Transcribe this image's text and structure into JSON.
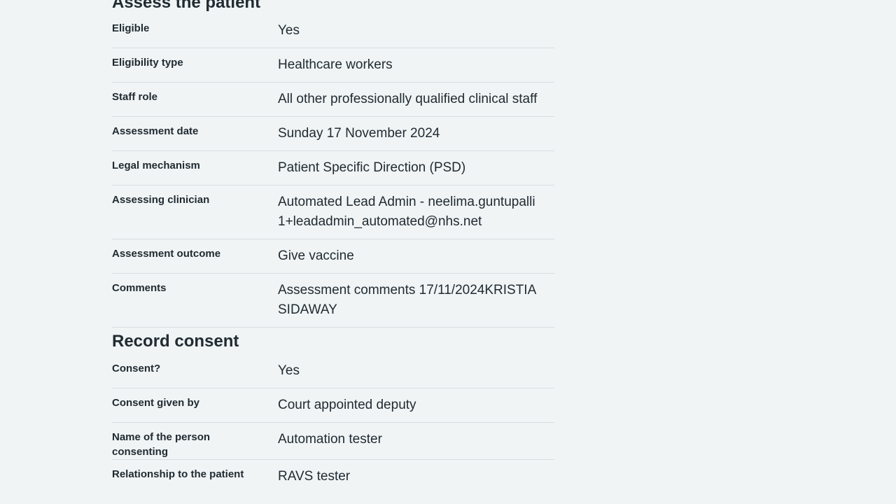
{
  "assess": {
    "heading": "Assess the patient",
    "rows": [
      {
        "key": "Eligible",
        "value": "Yes"
      },
      {
        "key": "Eligibility type",
        "value": "Healthcare workers"
      },
      {
        "key": "Staff role",
        "value": "All other professionally qualified clinical staff"
      },
      {
        "key": "Assessment date",
        "value": "Sunday 17 November 2024"
      },
      {
        "key": "Legal mechanism",
        "value": "Patient Specific Direction (PSD)"
      },
      {
        "key": "Assessing clinician",
        "value": "Automated Lead Admin - neelima.guntupalli1+leadadmin_automated@nhs.net"
      },
      {
        "key": "Assessment outcome",
        "value": "Give vaccine"
      },
      {
        "key": "Comments",
        "value": "Assessment comments 17/11/2024KRISTIA SIDAWAY"
      }
    ]
  },
  "consent": {
    "heading": "Record consent",
    "rows": [
      {
        "key": "Consent?",
        "value": "Yes"
      },
      {
        "key": "Consent given by",
        "value": "Court appointed deputy"
      },
      {
        "key": "Name of the person consenting",
        "value": "Automation tester"
      },
      {
        "key": "Relationship to the patient",
        "value": "RAVS tester"
      }
    ]
  }
}
